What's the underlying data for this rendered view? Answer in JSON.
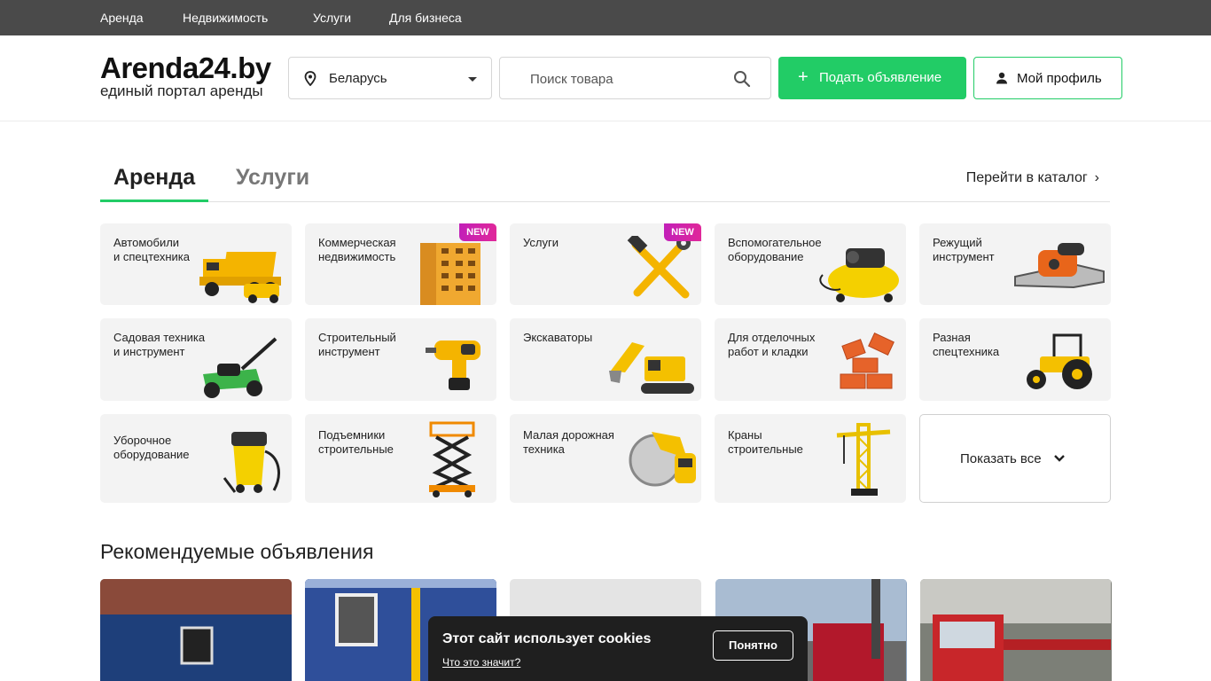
{
  "topnav": {
    "items": [
      "Аренда",
      "Недвижимость",
      "Услуги",
      "Для бизнеса"
    ]
  },
  "header": {
    "logo_title": "Arenda24.by",
    "logo_subtitle": "единый портал аренды",
    "region": "Беларусь",
    "search_placeholder": "Поиск товара",
    "add_button": "Подать объявление",
    "profile_button": "Мой профиль"
  },
  "tabs": {
    "items": [
      "Аренда",
      "Услуги"
    ],
    "active": "Аренда",
    "catalog_link": "Перейти в каталог"
  },
  "categories": [
    {
      "label": "Автомобили\nи спецтехника"
    },
    {
      "label": "Коммерческая\nнедвижимость",
      "badge": "NEW"
    },
    {
      "label": "Услуги",
      "badge": "NEW"
    },
    {
      "label": "Вспомогательное\nоборудование"
    },
    {
      "label": "Режущий\nинструмент"
    },
    {
      "label": "Садовая техника\nи инструмент"
    },
    {
      "label": "Строительный\nинструмент"
    },
    {
      "label": "Экскаваторы"
    },
    {
      "label": "Для отделочных\nработ и кладки"
    },
    {
      "label": "Разная\nспецтехника"
    },
    {
      "label": "Уборочное\nоборудование"
    },
    {
      "label": "Подъемники\nстроительные"
    },
    {
      "label": "Малая дорожная\nтехника"
    },
    {
      "label": "Краны\nстроительные"
    }
  ],
  "show_all": "Показать все",
  "recommended": {
    "title": "Рекомендуемые объявления"
  },
  "cookie": {
    "title": "Этот сайт использует cookies",
    "link": "Что это значит?",
    "button": "Понятно"
  },
  "colors": {
    "accent": "#22cc66",
    "topnav_bg": "#4a4a4a",
    "badge": "#d424a8"
  }
}
